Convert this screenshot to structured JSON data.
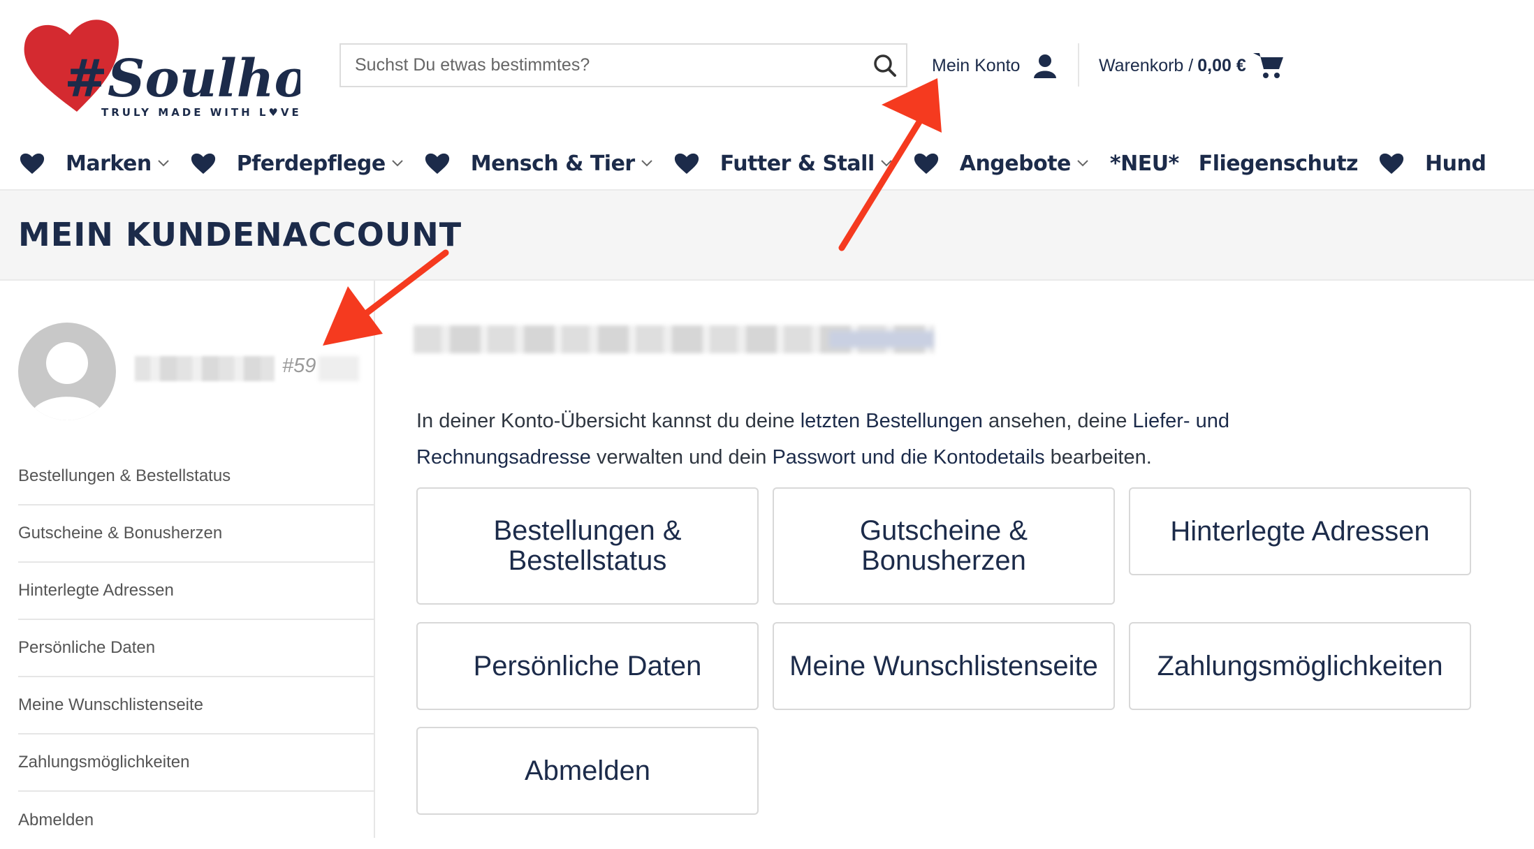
{
  "brand": {
    "logo_text": "#Soulhorse",
    "tagline": "TRULY MADE WITH L♥VE"
  },
  "header": {
    "search_placeholder": "Suchst Du etwas bestimmtes?",
    "account_label": "Mein Konto",
    "cart_label": "Warenkorb /",
    "cart_total": "0,00 €"
  },
  "nav": {
    "items": [
      {
        "label": "Marken"
      },
      {
        "label": "Pferdepflege"
      },
      {
        "label": "Mensch & Tier"
      },
      {
        "label": "Futter & Stall"
      },
      {
        "label": "Angebote"
      },
      {
        "label": "*NEU*"
      },
      {
        "label": "Fliegenschutz"
      },
      {
        "label": "Hund"
      }
    ]
  },
  "page": {
    "title": "MEIN KUNDENACCOUNT"
  },
  "user": {
    "id_prefix": "#59"
  },
  "sidebar": {
    "items": [
      {
        "label": "Bestellungen & Bestellstatus"
      },
      {
        "label": "Gutscheine & Bonusherzen"
      },
      {
        "label": "Hinterlegte Adressen"
      },
      {
        "label": "Persönliche Daten"
      },
      {
        "label": "Meine Wunschlistenseite"
      },
      {
        "label": "Zahlungsmöglichkeiten"
      },
      {
        "label": "Abmelden"
      }
    ]
  },
  "content": {
    "intro_1": "In deiner Konto-Übersicht kannst du deine ",
    "intro_link_1": "letzten Bestellungen",
    "intro_2": " ansehen, deine ",
    "intro_link_2": "Liefer- und Rechnungsadresse",
    "intro_3": " verwalten und dein ",
    "intro_link_3": "Passwort und die Kontodetails",
    "intro_4": " bearbeiten.",
    "tiles": [
      {
        "label": "Bestellungen & Bestellstatus"
      },
      {
        "label": "Gutscheine & Bonusherzen"
      },
      {
        "label": "Hinterlegte Adressen"
      },
      {
        "label": "Persönliche Daten"
      },
      {
        "label": "Meine Wunschlistenseite"
      },
      {
        "label": "Zahlungsmöglichkeiten"
      },
      {
        "label": "Abmelden"
      }
    ]
  },
  "colors": {
    "brand_navy": "#1c2b4a",
    "brand_red": "#d42a30",
    "annotation_red": "#f53a1f"
  }
}
